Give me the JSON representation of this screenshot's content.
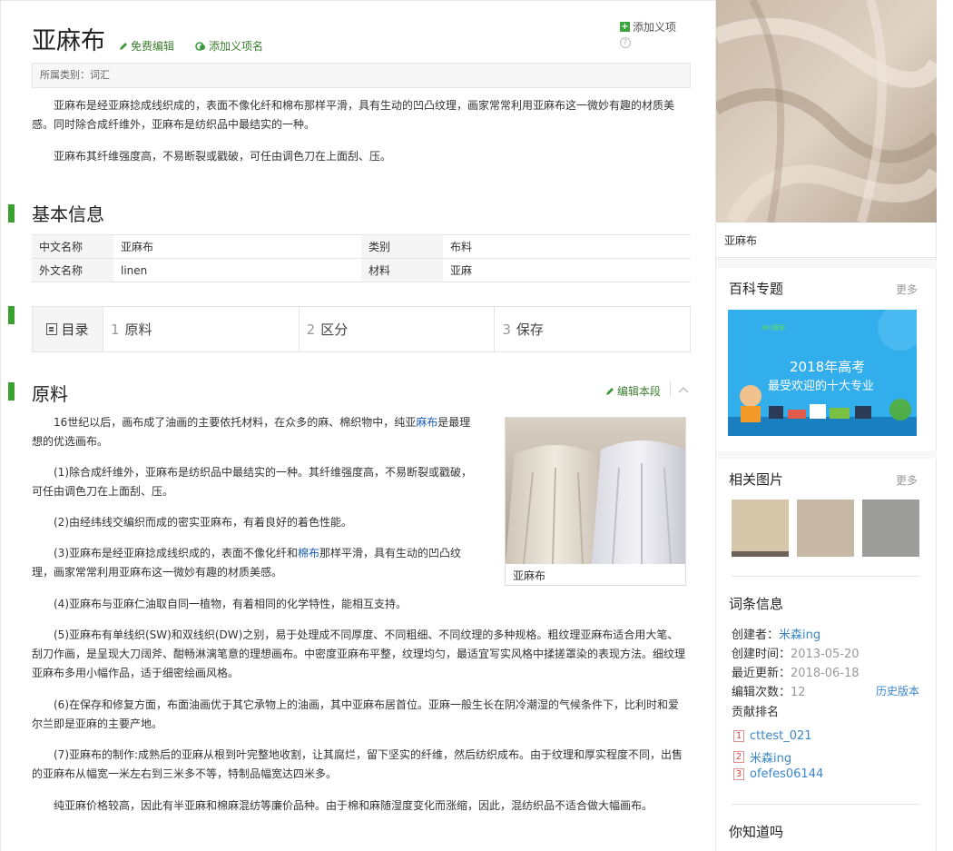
{
  "page": {
    "title": "亚麻布",
    "free_edit": "免费编辑",
    "add_meaning": "添加义项名",
    "add_item": "添加义项",
    "help": "?",
    "category": "所属类别：词汇"
  },
  "intro": {
    "p1": "亚麻布是经亚麻捻成线织成的，表面不像化纤和棉布那样平滑，具有生动的凹凸纹理，画家常常利用亚麻布这一微妙有趣的材质美感。同时除合成纤维外，亚麻布是纺织品中最结实的一种。",
    "p2": "亚麻布其纤维强度高，不易断裂或戳破，可任由调色刀在上面刮、压。"
  },
  "basic_info": {
    "heading": "基本信息",
    "rows": [
      [
        {
          "k": "中文名称",
          "v": "亚麻布"
        },
        {
          "k": "类别",
          "v": "布料"
        }
      ],
      [
        {
          "k": "外文名称",
          "v": "linen"
        },
        {
          "k": "材料",
          "v": "亚麻"
        }
      ]
    ]
  },
  "toc": {
    "label": "目录",
    "items": [
      {
        "num": "1",
        "label": "原料"
      },
      {
        "num": "2",
        "label": "区分"
      },
      {
        "num": "3",
        "label": "保存"
      }
    ]
  },
  "section": {
    "heading": "原料",
    "edit": "编辑本段",
    "figure_caption": "亚麻布",
    "p1_pre": "16世纪以后，画布成了油画的主要依托材料，在众多的麻、棉织物中，纯亚",
    "p1_link": "麻布",
    "p1_post": "是最理想的优选画布。",
    "p2": "(1)除合成纤维外，亚麻布是纺织品中最结实的一种。其纤维强度高，不易断裂或戳破，可任由调色刀在上面刮、压。",
    "p3": "(2)由经纬线交编织而成的密实亚麻布，有着良好的着色性能。",
    "p4_pre": "(3)亚麻布是经亚麻捻成线织成的，表面不像化纤和",
    "p4_link": "棉布",
    "p4_post": "那样平滑，具有生动的凹凸纹理，画家常常利用亚麻布这一微妙有趣的材质美感。",
    "p5": "(4)亚麻布与亚麻仁油取自同一植物，有着相同的化学特性，能相互支持。",
    "p6": "(5)亚麻布有单线织(SW)和双线织(DW)之别，易于处理成不同厚度、不同粗细、不同纹理的多种规格。粗纹理亚麻布适合用大笔、刮刀作画，是呈现大刀阔斧、酣畅淋漓笔意的理想画布。中密度亚麻布平整，纹理均匀，最适宜写实风格中揉搓罩染的表现方法。细纹理亚麻布多用小幅作品，适于细密绘画风格。",
    "p7": "(6)在保存和修复方面，布面油画优于其它承物上的油画，其中亚麻布居首位。亚麻一般生长在阴冷潮湿的气候条件下，比利时和爱尔兰即是亚麻的主要产地。",
    "p8": "(7)亚麻布的制作:成熟后的亚麻从根到叶完整地收割，让其腐烂，留下坚实的纤维，然后纺织成布。由于纹理和厚实程度不同，出售的亚麻布从幅宽一米左右到三米多不等，特制品幅宽达四米多。",
    "p9": "纯亚麻价格较高，因此有半亚麻和棉麻混纺等廉价品种。由于棉和麻随湿度变化而涨缩，因此，混纺织品不适合做大幅画布。"
  },
  "sidebar": {
    "hero_caption": "亚麻布",
    "topics_title": "百科专题",
    "topics_more": "更多",
    "banner_brand": "360搜索",
    "banner_line1": "2018年高考",
    "banner_line2": "最受欢迎的十大专业",
    "related_title": "相关图片",
    "related_more": "更多",
    "entry_title": "词条信息",
    "creator_label": "创建者：",
    "creator": "米森ing",
    "created_label": "创建时间：",
    "created": "2013-05-20",
    "updated_label": "最近更新：",
    "updated": "2018-06-18",
    "edits_label": "编辑次数：",
    "edits": "12",
    "history": "历史版本",
    "rank_title": "贡献排名",
    "ranks": [
      {
        "n": "1",
        "name": "cttest_021"
      },
      {
        "n": "2",
        "name": "米森ing"
      },
      {
        "n": "3",
        "name": "ofefes06144"
      }
    ],
    "know_title": "你知道吗"
  },
  "colors": {
    "accent_green": "#39a22f",
    "link_blue": "#3a86c8",
    "rank_red": "#d04343"
  }
}
